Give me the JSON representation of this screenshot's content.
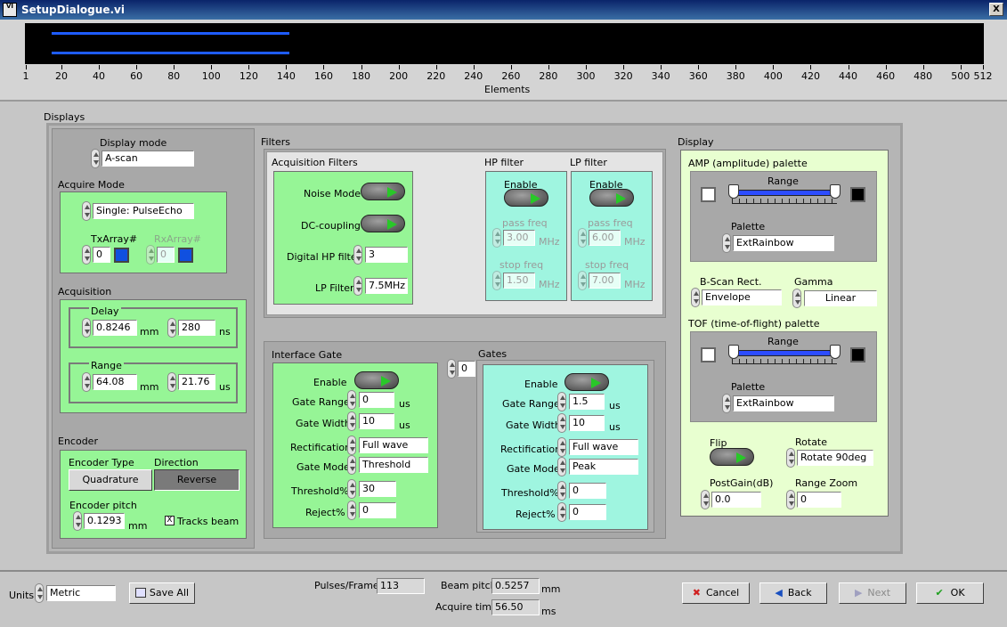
{
  "window": {
    "title": "SetupDialogue.vi",
    "close": "X",
    "icon_label": "VI"
  },
  "top": {
    "xlabel": "Elements",
    "ticks": [
      "1",
      "20",
      "40",
      "60",
      "80",
      "100",
      "120",
      "140",
      "160",
      "180",
      "200",
      "220",
      "240",
      "260",
      "280",
      "300",
      "320",
      "340",
      "360",
      "380",
      "400",
      "420",
      "440",
      "460",
      "480",
      "500",
      "512"
    ],
    "bar_extent_elements": 128
  },
  "displays_label": "Displays",
  "left": {
    "display_mode": {
      "label": "Display mode",
      "value": "A-scan"
    },
    "acquire_mode": {
      "label": "Acquire Mode",
      "value": "Single: PulseEcho",
      "tx_label": "TxArray#",
      "tx_value": "0",
      "rx_label": "RxArray#",
      "rx_value": "0"
    },
    "acquisition": {
      "label": "Acquisition",
      "delay_label": "Delay",
      "delay_mm": "0.8246",
      "delay_mm_unit": "mm",
      "delay_ns": "280",
      "delay_ns_unit": "ns",
      "range_label": "Range",
      "range_mm": "64.08",
      "range_mm_unit": "mm",
      "range_us": "21.76",
      "range_us_unit": "us"
    },
    "encoder": {
      "label": "Encoder",
      "type_label": "Encoder Type",
      "direction_label": "Direction",
      "type_value": "Quadrature",
      "direction_value": "Reverse",
      "pitch_label": "Encoder pitch",
      "pitch_value": "0.1293",
      "pitch_unit": "mm",
      "tracks_label": "Tracks beam",
      "tracks_checked": "X"
    }
  },
  "filters": {
    "label": "Filters",
    "acq_label": "Acquisition Filters",
    "noise_label": "Noise Mode",
    "dc_label": "DC-coupling",
    "dhp_label": "Digital HP filter",
    "dhp_value": "3",
    "lp_label": "LP Filter",
    "lp_value": "7.5MHz",
    "hp": {
      "label": "HP filter",
      "enable": "Enable",
      "pass_label": "pass freq",
      "pass_value": "3.00",
      "pass_unit": "MHz",
      "stop_label": "stop freq",
      "stop_value": "1.50",
      "stop_unit": "MHz"
    },
    "lpf": {
      "label": "LP filter",
      "enable": "Enable",
      "pass_label": "pass freq",
      "pass_value": "6.00",
      "pass_unit": "MHz",
      "stop_label": "stop freq",
      "stop_value": "7.00",
      "stop_unit": "MHz"
    }
  },
  "interface_gate": {
    "label": "Interface Gate",
    "enable": "Enable",
    "gate_range_label": "Gate Range",
    "gate_range": "0",
    "gate_range_unit": "us",
    "gate_width_label": "Gate Width",
    "gate_width": "10",
    "gate_width_unit": "us",
    "rect_label": "Rectification",
    "rect": "Full wave",
    "mode_label": "Gate Mode",
    "mode": "Threshold",
    "thr_label": "Threshold%",
    "thr": "30",
    "rej_label": "Reject%",
    "rej": "0"
  },
  "gates": {
    "index": "0",
    "label": "Gates",
    "enable": "Enable",
    "gate_range_label": "Gate Range",
    "gate_range": "1.5",
    "gate_range_unit": "us",
    "gate_width_label": "Gate Width",
    "gate_width": "10",
    "gate_width_unit": "us",
    "rect_label": "Rectification",
    "rect": "Full wave",
    "mode_label": "Gate Mode",
    "mode": "Peak",
    "thr_label": "Threshold%",
    "thr": "0",
    "rej_label": "Reject%",
    "rej": "0"
  },
  "display": {
    "label": "Display",
    "amp_label": "AMP (amplitude) palette",
    "amp_range": "Range",
    "amp_palette_label": "Palette",
    "amp_palette": "ExtRainbow",
    "bscan_label": "B-Scan Rect.",
    "bscan": "Envelope",
    "gamma_label": "Gamma",
    "gamma": "Linear",
    "tof_label": "TOF (time-of-flight) palette",
    "tof_range": "Range",
    "tof_palette_label": "Palette",
    "tof_palette": "ExtRainbow",
    "flip_label": "Flip",
    "rotate_label": "Rotate",
    "rotate": "Rotate 90deg",
    "postgain_label": "PostGain(dB)",
    "postgain": "0.0",
    "rangezoom_label": "Range Zoom",
    "rangezoom": "0"
  },
  "bottom": {
    "units_label": "Units",
    "units": "Metric",
    "save_all": "Save All",
    "pulses_label": "Pulses/Frame",
    "pulses": "113",
    "beam_pitch_label": "Beam pitch",
    "beam_pitch": "0.5257",
    "beam_pitch_unit": "mm",
    "acq_time_label": "Acquire time",
    "acq_time": "56.50",
    "acq_time_unit": "ms",
    "cancel": "Cancel",
    "back": "Back",
    "next": "Next",
    "ok": "OK"
  },
  "colors": {
    "green_panel": "#96f596",
    "cyan_panel": "#9ff5e0",
    "pale_panel": "#e8ffd0",
    "bar": "#1e5cff",
    "led_green": "#28c828"
  }
}
